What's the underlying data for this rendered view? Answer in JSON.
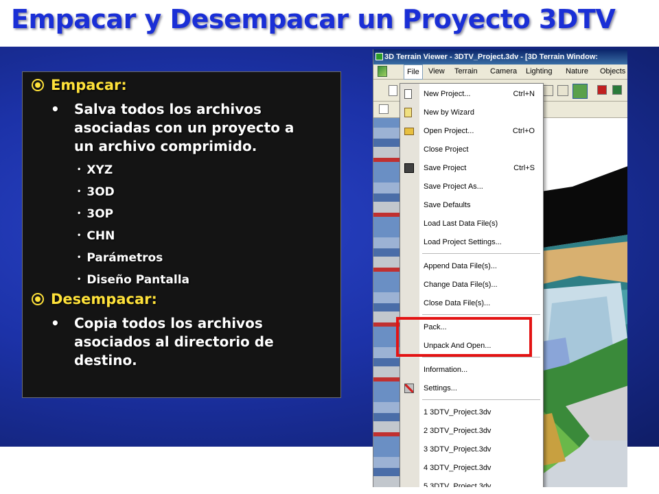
{
  "slide": {
    "title": "Empacar y Desempacar un Proyecto 3DTV",
    "sections": [
      {
        "heading": "Empacar:",
        "text": [
          "Salva todos los archivos",
          "asociadas con un proyecto a",
          "un archivo comprimido."
        ],
        "items": [
          "XYZ",
          "3OD",
          "3OP",
          "CHN",
          "Parámetros",
          "Diseño Pantalla"
        ]
      },
      {
        "heading": "Desempacar:",
        "text": [
          "Copia todos los archivos",
          "asociados al directorio de",
          "destino."
        ]
      }
    ]
  },
  "app": {
    "window_title": "3D Terrain Viewer - 3DTV_Project.3dv - [3D Terrain Window:",
    "menubar": [
      "File",
      "View",
      "Terrain",
      "Camera",
      "Lighting",
      "Nature",
      "Objects"
    ],
    "file_menu": [
      {
        "label": "New Project...",
        "shortcut": "Ctrl+N"
      },
      {
        "label": "New by Wizard",
        "shortcut": ""
      },
      {
        "label": "Open Project...",
        "shortcut": "Ctrl+O"
      },
      {
        "label": "Close Project",
        "shortcut": ""
      },
      {
        "label": "Save Project",
        "shortcut": "Ctrl+S"
      },
      {
        "label": "Save Project As...",
        "shortcut": ""
      },
      {
        "label": "Save Defaults",
        "shortcut": ""
      },
      {
        "label": "Load Last Data File(s)",
        "shortcut": ""
      },
      {
        "label": "Load Project Settings...",
        "shortcut": ""
      },
      {
        "label": "Append Data File(s)...",
        "shortcut": ""
      },
      {
        "label": "Change Data File(s)...",
        "shortcut": ""
      },
      {
        "label": "Close Data File(s)...",
        "shortcut": ""
      },
      {
        "label": "Pack...",
        "shortcut": ""
      },
      {
        "label": "Unpack And Open...",
        "shortcut": ""
      },
      {
        "label": "Information...",
        "shortcut": ""
      },
      {
        "label": "Settings...",
        "shortcut": ""
      },
      {
        "label": "1 3DTV_Project.3dv",
        "shortcut": ""
      },
      {
        "label": "2 3DTV_Project.3dv",
        "shortcut": ""
      },
      {
        "label": "3 3DTV_Project.3dv",
        "shortcut": ""
      },
      {
        "label": "4 3DTV_Project.3dv",
        "shortcut": ""
      },
      {
        "label": "5 3DTV_Project.3dv",
        "shortcut": ""
      }
    ],
    "highlight_color": "#e31313"
  }
}
